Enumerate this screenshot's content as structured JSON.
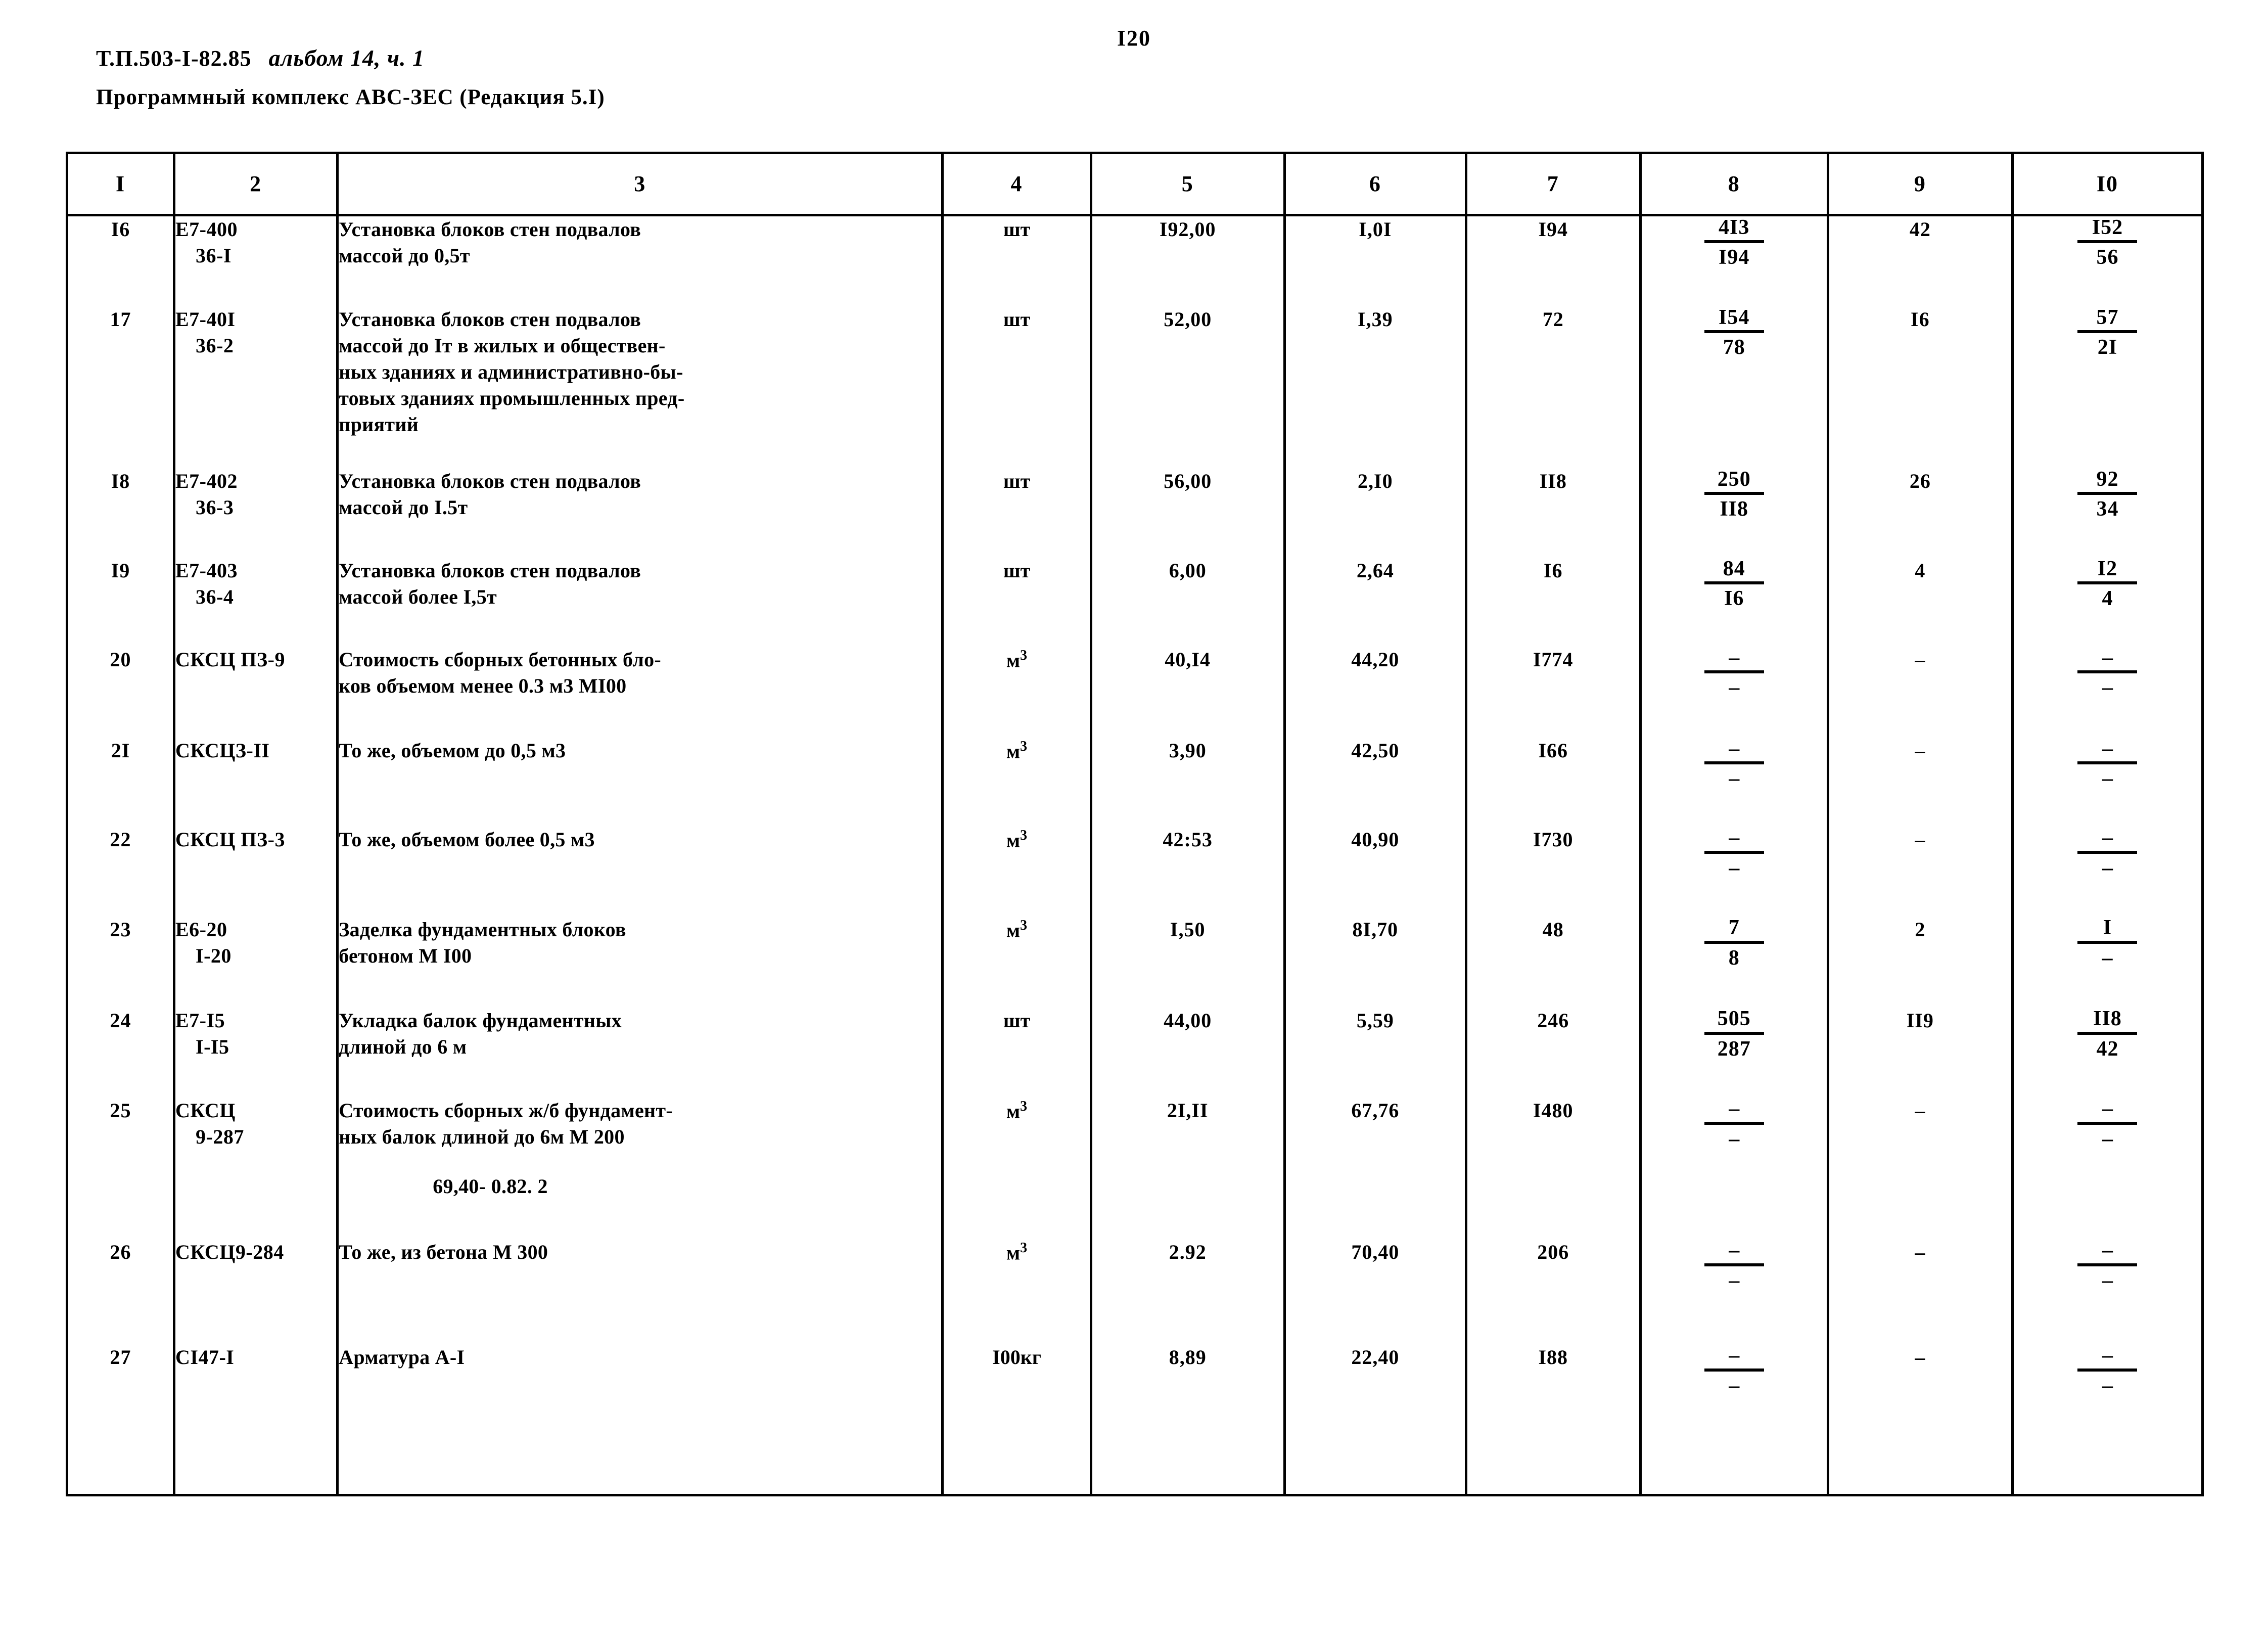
{
  "page": {
    "number": "I20",
    "doc_code": "Т.П.503-I-82.85",
    "album": "альбом 14, ч. 1",
    "subtitle": "Программный комплекс АВС-ЗЕС (Редакция 5.I)"
  },
  "table": {
    "column_headers": [
      "I",
      "2",
      "3",
      "4",
      "5",
      "6",
      "7",
      "8",
      "9",
      "I0"
    ],
    "rows": [
      {
        "n": "I6",
        "code_l1": "Е7-400",
        "code_l2": "36-I",
        "desc": "Установка блоков стен подвалов\nмассой до 0,5т",
        "unit": "шт",
        "c5": "I92,00",
        "c6": "I,0I",
        "c7": "I94",
        "c8_top": "4I3",
        "c8_bot": "I94",
        "c9": "42",
        "c10_top": "I52",
        "c10_bot": "56"
      },
      {
        "n": "17",
        "code_l1": "Е7-40I",
        "code_l2": "36-2",
        "desc": "Установка блоков стен подвалов\nмассой до Iт в жилых и обществен-\nных зданиях и административно-бы-\nтовых зданиях промышленных пред-\nприятий",
        "unit": "шт",
        "c5": "52,00",
        "c6": "I,39",
        "c7": "72",
        "c8_top": "I54",
        "c8_bot": "78",
        "c9": "I6",
        "c10_top": "57",
        "c10_bot": "2I"
      },
      {
        "n": "I8",
        "code_l1": "Е7-402",
        "code_l2": "36-3",
        "desc": "Установка блоков стен подвалов\nмассой до I.5т",
        "unit": "шт",
        "c5": "56,00",
        "c6": "2,I0",
        "c7": "II8",
        "c8_top": "250",
        "c8_bot": "II8",
        "c9": "26",
        "c10_top": "92",
        "c10_bot": "34"
      },
      {
        "n": "I9",
        "code_l1": "Е7-403",
        "code_l2": "36-4",
        "desc": "Установка блоков стен подвалов\nмассой более I,5т",
        "unit": "шт",
        "c5": "6,00",
        "c6": "2,64",
        "c7": "I6",
        "c8_top": "84",
        "c8_bot": "I6",
        "c9": "4",
        "c10_top": "I2",
        "c10_bot": "4"
      },
      {
        "n": "20",
        "code_l1": "СКСЦ ПЗ-9",
        "code_l2": "",
        "desc": "Стоимость сборных бетонных бло-\nков объемом менее 0.3 м3 МI00",
        "unit": "м3",
        "c5": "40,I4",
        "c6": "44,20",
        "c7": "I774",
        "c8_top": "–",
        "c8_bot": "–",
        "c9": "–",
        "c10_top": "–",
        "c10_bot": "–"
      },
      {
        "n": "2I",
        "code_l1": "СКСЦЗ-II",
        "code_l2": "",
        "desc": "То же, объемом до 0,5 м3",
        "unit": "м3",
        "c5": "3,90",
        "c6": "42,50",
        "c7": "I66",
        "c8_top": "–",
        "c8_bot": "–",
        "c9": "–",
        "c10_top": "–",
        "c10_bot": "–"
      },
      {
        "n": "22",
        "code_l1": "СКСЦ ПЗ-3",
        "code_l2": "",
        "desc": "То же, объемом более 0,5 м3",
        "unit": "м3",
        "c5": "42:53",
        "c6": "40,90",
        "c7": "I730",
        "c8_top": "–",
        "c8_bot": "–",
        "c9": "–",
        "c10_top": "–",
        "c10_bot": "–"
      },
      {
        "n": "23",
        "code_l1": "Е6-20",
        "code_l2": "I-20",
        "desc": "Заделка фундаментных блоков\nбетоном М I00",
        "unit": "м3",
        "c5": "I,50",
        "c6": "8I,70",
        "c7": "48",
        "c8_top": "7",
        "c8_bot": "8",
        "c9": "2",
        "c10_top": "I",
        "c10_bot": "–"
      },
      {
        "n": "24",
        "code_l1": "Е7-I5",
        "code_l2": "I-I5",
        "desc": "Укладка балок фундаментных\nдлиной до 6 м",
        "unit": "шт",
        "c5": "44,00",
        "c6": "5,59",
        "c7": "246",
        "c8_top": "505",
        "c8_bot": "287",
        "c9": "II9",
        "c10_top": "II8",
        "c10_bot": "42"
      },
      {
        "n": "25",
        "code_l1": "СКСЦ",
        "code_l2": "9-287",
        "desc": "Стоимость сборных ж/б фундамент-\nных балок длиной до 6м М 200",
        "desc_extra": "69,40- 0.82. 2",
        "unit": "м3",
        "c5": "2I,II",
        "c6": "67,76",
        "c7": "I480",
        "c8_top": "–",
        "c8_bot": "–",
        "c9": "–",
        "c10_top": "–",
        "c10_bot": "–"
      },
      {
        "n": "26",
        "code_l1": "СКСЦ9-284",
        "code_l2": "",
        "desc": "То же, из бетона М 300",
        "unit": "м3",
        "c5": "2.92",
        "c6": "70,40",
        "c7": "206",
        "c8_top": "–",
        "c8_bot": "–",
        "c9": "–",
        "c10_top": "–",
        "c10_bot": "–"
      },
      {
        "n": "27",
        "code_l1": "СI47-I",
        "code_l2": "",
        "desc": "Арматура А-I",
        "unit": "I00кг",
        "c5": "8,89",
        "c6": "22,40",
        "c7": "I88",
        "c8_top": "–",
        "c8_bot": "–",
        "c9": "–",
        "c10_top": "–",
        "c10_bot": "–"
      }
    ]
  }
}
